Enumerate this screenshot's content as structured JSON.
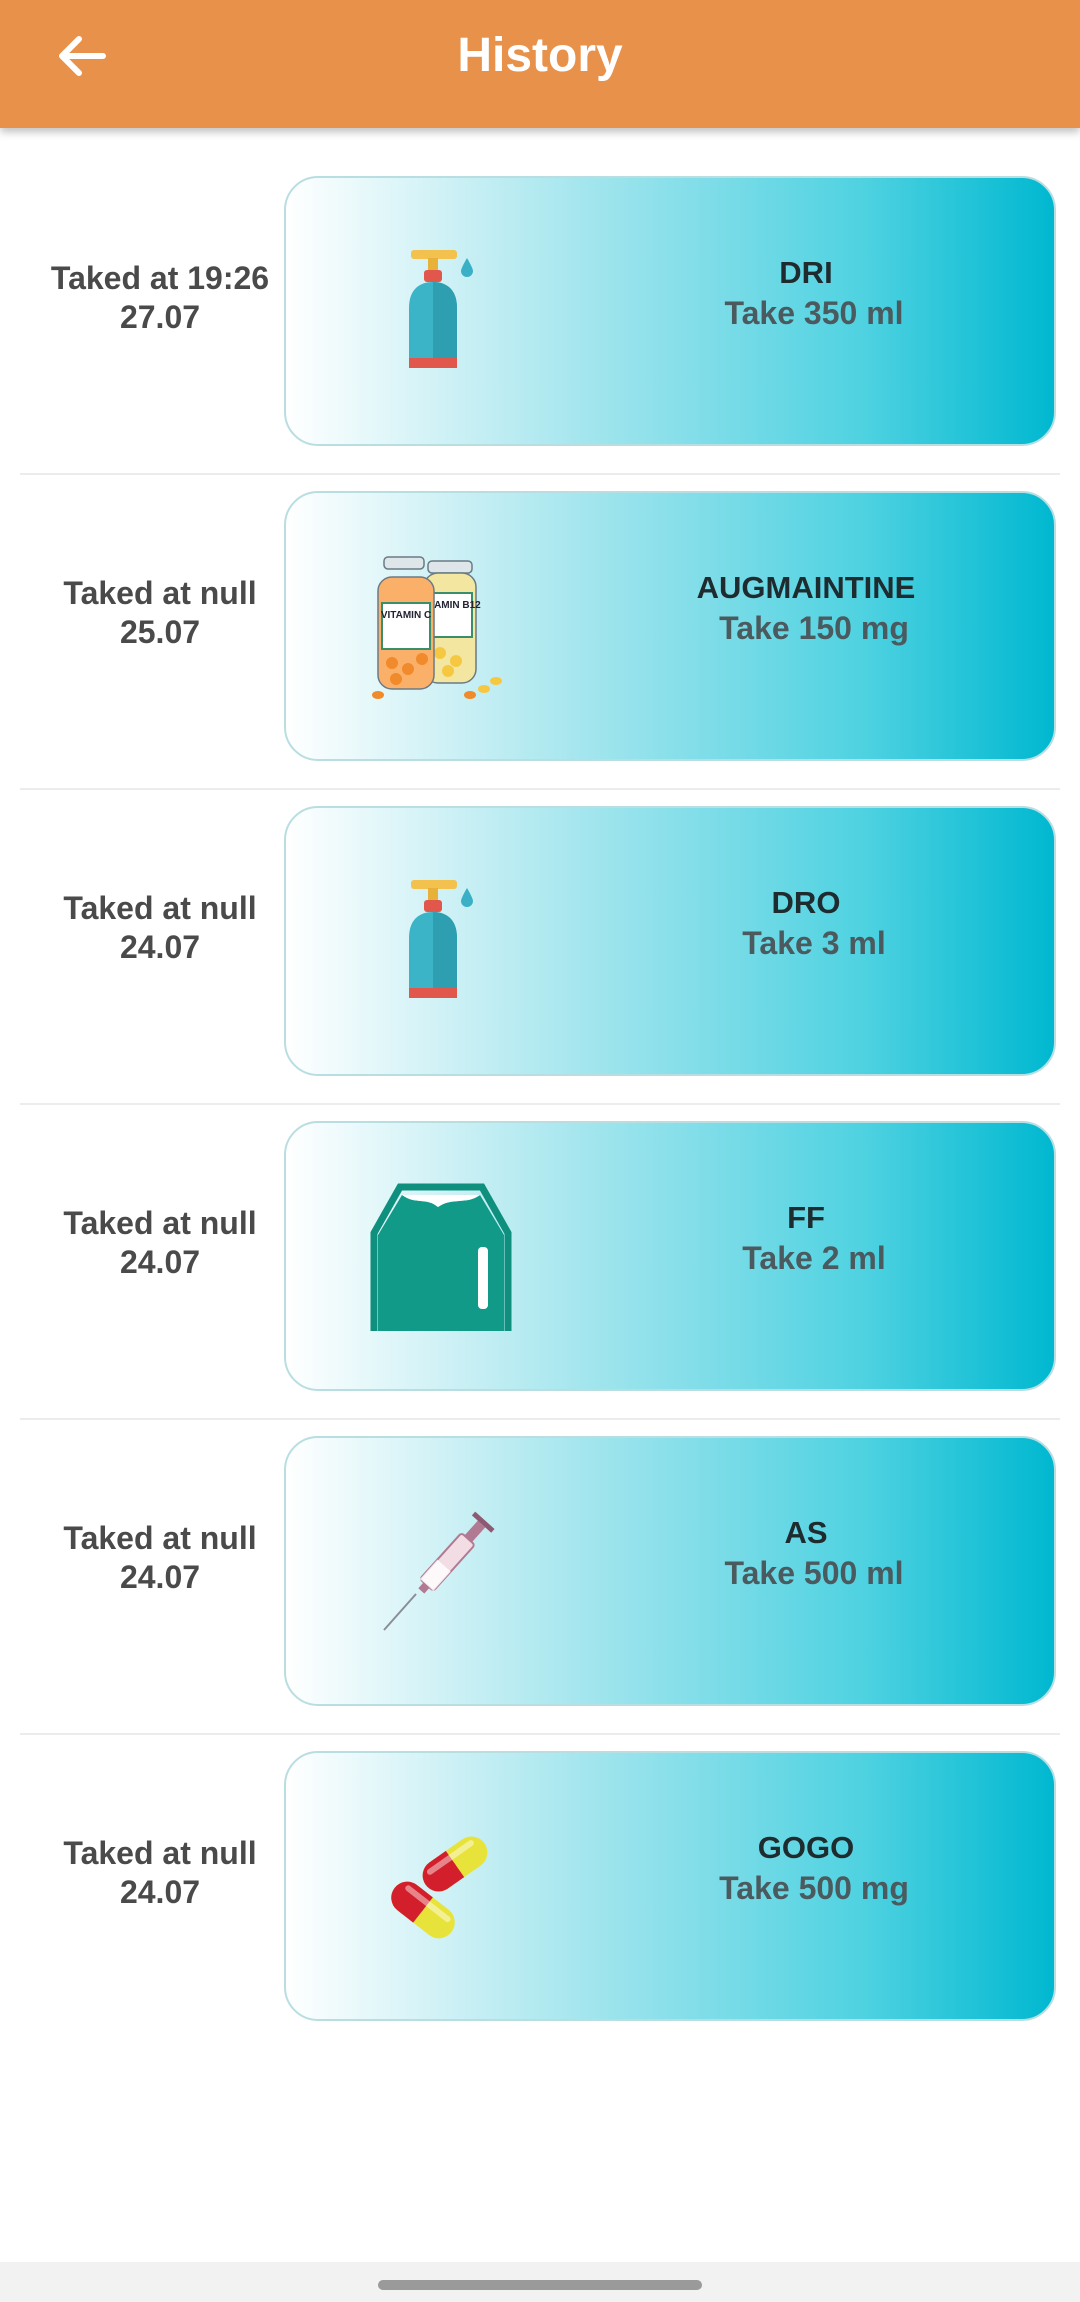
{
  "header": {
    "title": "History",
    "background": "#e8914a",
    "back_icon": "arrow-left-icon"
  },
  "history": [
    {
      "taken_line": "Taked at 19:26",
      "date": "27.07",
      "name": "DRI",
      "dose": "Take 350 ml",
      "icon": "dropper-bottle-icon"
    },
    {
      "taken_line": "Taked at null",
      "date": "25.07",
      "name": "AUGMAINTINE",
      "dose": "Take 150 mg",
      "icon": "vitamin-bottles-icon",
      "icon_text": [
        "VITAMIN C",
        "VITAMIN B12"
      ]
    },
    {
      "taken_line": "Taked at null",
      "date": "24.07",
      "name": "DRO",
      "dose": "Take 3 ml",
      "icon": "dropper-bottle-icon"
    },
    {
      "taken_line": "Taked at null",
      "date": "24.07",
      "name": "FF",
      "dose": "Take 2 ml",
      "icon": "iv-bag-icon"
    },
    {
      "taken_line": "Taked at null",
      "date": "24.07",
      "name": "AS",
      "dose": "Take 500 ml",
      "icon": "syringe-icon"
    },
    {
      "taken_line": "Taked at null",
      "date": "24.07",
      "name": "GOGO",
      "dose": "Take 500 mg",
      "icon": "capsules-icon"
    }
  ],
  "colors": {
    "accent": "#e8914a",
    "card_gradient_end": "#00b8d0",
    "card_border": "#b9dee2"
  }
}
